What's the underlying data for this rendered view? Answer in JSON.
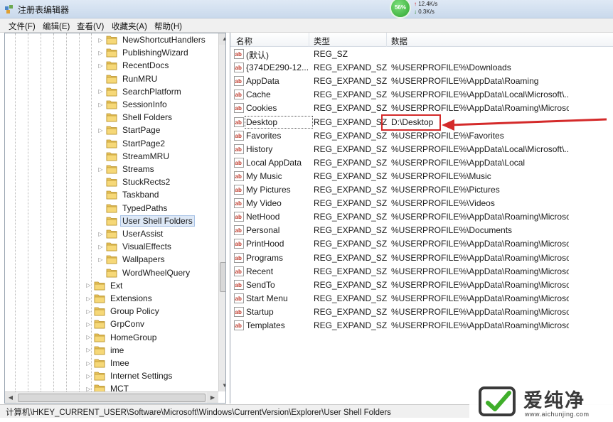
{
  "window": {
    "title": "注册表编辑器",
    "app_icon": "regedit-icon"
  },
  "net_monitor": {
    "percent": "56%",
    "upload": "12.4K/s",
    "download": "0.3K/s",
    "accent": "#2ea52e"
  },
  "menu": [
    "文件(F)",
    "编辑(E)",
    "查看(V)",
    "收藏夹(A)",
    "帮助(H)"
  ],
  "tree": {
    "nodes": [
      {
        "label": "NewShortcutHandlers",
        "expandable": true
      },
      {
        "label": "PublishingWizard",
        "expandable": true
      },
      {
        "label": "RecentDocs",
        "expandable": true
      },
      {
        "label": "RunMRU",
        "expandable": false
      },
      {
        "label": "SearchPlatform",
        "expandable": true
      },
      {
        "label": "SessionInfo",
        "expandable": true
      },
      {
        "label": "Shell Folders",
        "expandable": false
      },
      {
        "label": "StartPage",
        "expandable": true
      },
      {
        "label": "StartPage2",
        "expandable": false
      },
      {
        "label": "StreamMRU",
        "expandable": false
      },
      {
        "label": "Streams",
        "expandable": true
      },
      {
        "label": "StuckRects2",
        "expandable": false
      },
      {
        "label": "Taskband",
        "expandable": false
      },
      {
        "label": "TypedPaths",
        "expandable": false
      },
      {
        "label": "User Shell Folders",
        "expandable": false,
        "selected": true
      },
      {
        "label": "UserAssist",
        "expandable": true
      },
      {
        "label": "VisualEffects",
        "expandable": true
      },
      {
        "label": "Wallpapers",
        "expandable": true
      },
      {
        "label": "WordWheelQuery",
        "expandable": false
      },
      {
        "label": "Ext",
        "expandable": true,
        "parent_level": true
      },
      {
        "label": "Extensions",
        "expandable": true,
        "parent_level": true
      },
      {
        "label": "Group Policy",
        "expandable": true,
        "parent_level": true
      },
      {
        "label": "GrpConv",
        "expandable": true,
        "parent_level": true
      },
      {
        "label": "HomeGroup",
        "expandable": true,
        "parent_level": true
      },
      {
        "label": "ime",
        "expandable": true,
        "parent_level": true
      },
      {
        "label": "Imee",
        "expandable": true,
        "parent_level": true
      },
      {
        "label": "Internet Settings",
        "expandable": true,
        "parent_level": true
      },
      {
        "label": "MCT",
        "expandable": true,
        "parent_level": true
      }
    ]
  },
  "list": {
    "columns": [
      "名称",
      "类型",
      "数据"
    ],
    "rows": [
      {
        "name": "(默认)",
        "type": "REG_SZ",
        "data": ""
      },
      {
        "name": "{374DE290-12...",
        "type": "REG_EXPAND_SZ",
        "data": "%USERPROFILE%\\Downloads"
      },
      {
        "name": "AppData",
        "type": "REG_EXPAND_SZ",
        "data": "%USERPROFILE%\\AppData\\Roaming"
      },
      {
        "name": "Cache",
        "type": "REG_EXPAND_SZ",
        "data": "%USERPROFILE%\\AppData\\Local\\Microsoft\\..."
      },
      {
        "name": "Cookies",
        "type": "REG_EXPAND_SZ",
        "data": "%USERPROFILE%\\AppData\\Roaming\\Microso..."
      },
      {
        "name": "Desktop",
        "type": "REG_EXPAND_SZ",
        "data": "D:\\Desktop",
        "focused": true
      },
      {
        "name": "Favorites",
        "type": "REG_EXPAND_SZ",
        "data": "%USERPROFILE%\\Favorites"
      },
      {
        "name": "History",
        "type": "REG_EXPAND_SZ",
        "data": "%USERPROFILE%\\AppData\\Local\\Microsoft\\..."
      },
      {
        "name": "Local AppData",
        "type": "REG_EXPAND_SZ",
        "data": "%USERPROFILE%\\AppData\\Local"
      },
      {
        "name": "My Music",
        "type": "REG_EXPAND_SZ",
        "data": "%USERPROFILE%\\Music"
      },
      {
        "name": "My Pictures",
        "type": "REG_EXPAND_SZ",
        "data": "%USERPROFILE%\\Pictures"
      },
      {
        "name": "My Video",
        "type": "REG_EXPAND_SZ",
        "data": "%USERPROFILE%\\Videos"
      },
      {
        "name": "NetHood",
        "type": "REG_EXPAND_SZ",
        "data": "%USERPROFILE%\\AppData\\Roaming\\Microso..."
      },
      {
        "name": "Personal",
        "type": "REG_EXPAND_SZ",
        "data": "%USERPROFILE%\\Documents"
      },
      {
        "name": "PrintHood",
        "type": "REG_EXPAND_SZ",
        "data": "%USERPROFILE%\\AppData\\Roaming\\Microso..."
      },
      {
        "name": "Programs",
        "type": "REG_EXPAND_SZ",
        "data": "%USERPROFILE%\\AppData\\Roaming\\Microso..."
      },
      {
        "name": "Recent",
        "type": "REG_EXPAND_SZ",
        "data": "%USERPROFILE%\\AppData\\Roaming\\Microso..."
      },
      {
        "name": "SendTo",
        "type": "REG_EXPAND_SZ",
        "data": "%USERPROFILE%\\AppData\\Roaming\\Microso..."
      },
      {
        "name": "Start Menu",
        "type": "REG_EXPAND_SZ",
        "data": "%USERPROFILE%\\AppData\\Roaming\\Microso..."
      },
      {
        "name": "Startup",
        "type": "REG_EXPAND_SZ",
        "data": "%USERPROFILE%\\AppData\\Roaming\\Microso..."
      },
      {
        "name": "Templates",
        "type": "REG_EXPAND_SZ",
        "data": "%USERPROFILE%\\AppData\\Roaming\\Microso..."
      }
    ]
  },
  "annotation": {
    "color": "#d42a2a"
  },
  "status": {
    "path": "计算机\\HKEY_CURRENT_USER\\Software\\Microsoft\\Windows\\CurrentVersion\\Explorer\\User Shell Folders"
  },
  "watermark": {
    "name": "爱纯净",
    "url": "www.aichunjing.com",
    "accent": "#3fae2a"
  }
}
